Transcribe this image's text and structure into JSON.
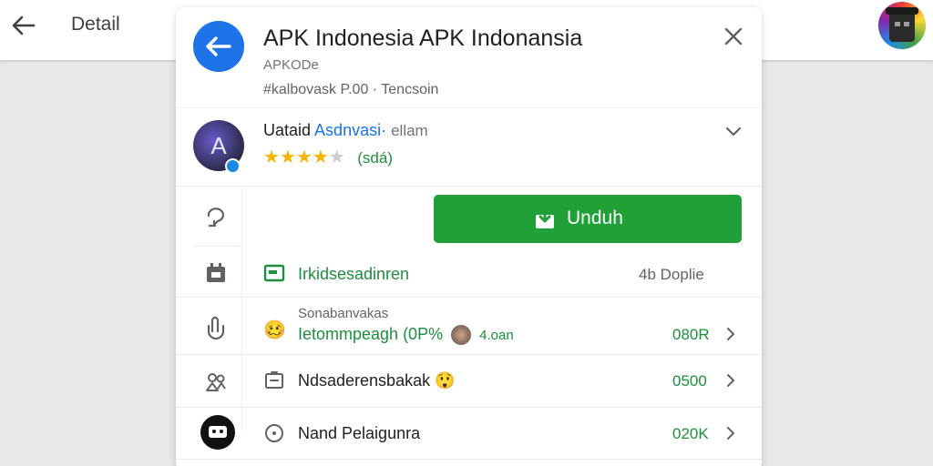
{
  "topbar": {
    "back_icon": "arrow-left-icon",
    "title": "Detail",
    "avatar_icon": "user-avatar-icon"
  },
  "app": {
    "icon": "arrow-left-circle-icon",
    "title": "APK Indonesia APK Indonansia",
    "subtitle": "APKODe",
    "meta": "#kalbovask  P.00 ·  Tencsoin",
    "close_icon": "close-icon"
  },
  "developer": {
    "avatar_letter": "A",
    "name_plain": "Uataid",
    "name_blue": "Asdnvasi·",
    "name_gray": "ellam",
    "stars_filled": 4,
    "stars_total": 5,
    "rating_count": "(sdá)",
    "expand_icon": "chevron-down-icon"
  },
  "actions": {
    "download_label": "Unduh",
    "download_icon": "download-icon"
  },
  "rows": [
    {
      "side_icon": "speech-bubble-icon"
    },
    {
      "side_icon": "calendar-icon",
      "icon": "screen-green-icon",
      "text": "Irkidsesadinren",
      "value": "4b Doplie"
    },
    {
      "side_icon": "touch-icon",
      "caption": "Sonabanvakas",
      "icon": "emoji-icon",
      "text": "Ietommpeagh (0P%",
      "extra": "4.oan",
      "value": "080R"
    },
    {
      "side_icon": "people-icon",
      "icon": "document-icon",
      "text": "Ndsaderensbakak",
      "value": "0500"
    },
    {
      "side_icon": "chat-bubble-black-icon",
      "icon": "info-circle-icon",
      "text": "Nand Pelaigunra",
      "value": "020K"
    }
  ],
  "colors": {
    "accent_blue": "#1e73e8",
    "download_green": "#21a038",
    "value_green": "#1e8e3e",
    "star_gold": "#f4b400"
  }
}
